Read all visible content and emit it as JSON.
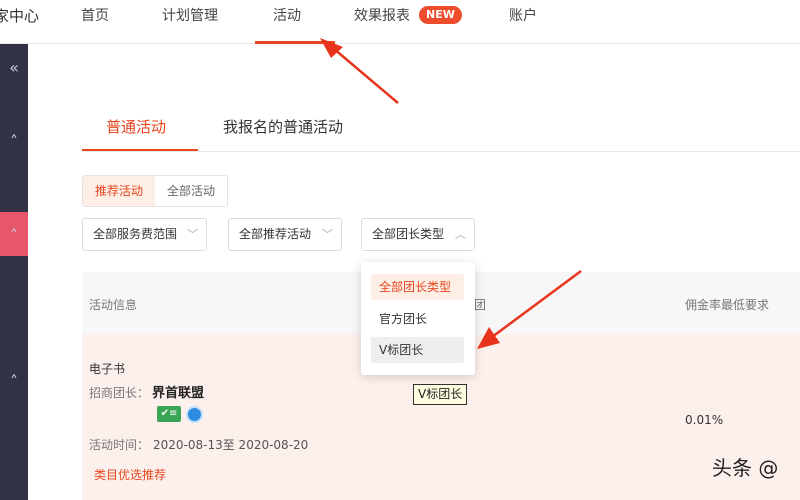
{
  "header": {
    "brand": "家中心",
    "nav": [
      "首页",
      "计划管理",
      "活动",
      "效果报表",
      "账户"
    ],
    "new_badge": "NEW"
  },
  "sidebar": {
    "icons": [
      "double-chevron-left-icon",
      "chevron-up-icon",
      "chevron-up-icon",
      "chevron-up-icon"
    ]
  },
  "tabs": [
    "普通活动",
    "我报名的普通活动"
  ],
  "segment": [
    "推荐活动",
    "全部活动"
  ],
  "filters": {
    "service_fee": "全部服务费范围",
    "recommend": "全部推荐活动",
    "leader_type": "全部团长类型"
  },
  "dropdown": {
    "options": [
      "全部团长类型",
      "官方团长",
      "V标团长"
    ]
  },
  "table": {
    "headers": [
      "活动信息",
      "佣金率最低要求"
    ],
    "partial_header": "团",
    "row": {
      "product": "电子书",
      "leader_label": "招商团长：",
      "leader_name": "界首联盟",
      "badge_text": "认证",
      "time_label": "活动时间：",
      "time_range": "2020-08-13至 2020-08-20",
      "category_tag": "类目优选推荐",
      "v_tag": "V标团长",
      "commission": "0.01%"
    }
  },
  "watermark": "头条 @",
  "colors": {
    "accent": "#e8461e",
    "sidebar": "#323245",
    "sidebar_active": "#e8566b",
    "arrow": "#e8341c"
  }
}
